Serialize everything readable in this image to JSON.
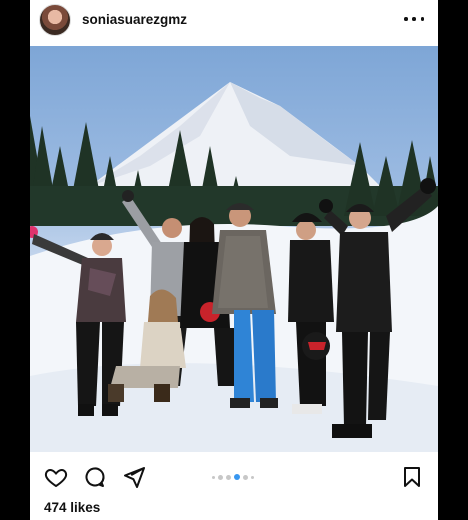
{
  "post": {
    "username": "soniasuarezgmz",
    "likes": "474 likes"
  },
  "carousel": {
    "total": 6,
    "active_index": 3
  },
  "colors": {
    "accent": "#3897f0",
    "text": "#111111"
  },
  "icons": {
    "more": "more-options-icon",
    "like": "heart-icon",
    "comment": "comment-icon",
    "share": "paper-plane-icon",
    "save": "bookmark-icon"
  }
}
